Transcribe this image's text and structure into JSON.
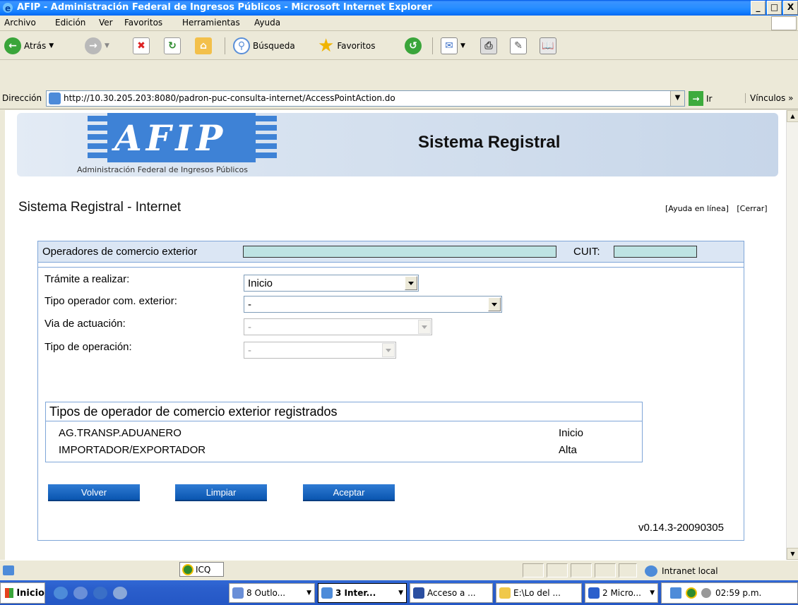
{
  "window": {
    "title": "AFIP - Administración Federal de Ingresos Públicos - Microsoft Internet Explorer",
    "min": "_",
    "max": "□",
    "close": "X"
  },
  "menu": [
    "Archivo",
    "Edición",
    "Ver",
    "Favoritos",
    "Herramientas",
    "Ayuda"
  ],
  "toolbar": {
    "back": "Atrás",
    "search": "Búsqueda",
    "favorites": "Favoritos"
  },
  "address": {
    "label": "Dirección",
    "url": "http://10.30.205.203:8080/padron-puc-consulta-internet/AccessPointAction.do",
    "go": "Ir",
    "links": "Vínculos »"
  },
  "header": {
    "logo_text": "AFIP",
    "agency": "Administración Federal de Ingresos Públicos",
    "system_title": "Sistema Registral"
  },
  "page": {
    "title": "Sistema Registral - Internet",
    "help_link": "[Ayuda en línea]",
    "close_link": "[Cerrar]"
  },
  "panel": {
    "operators_label": "Operadores de comercio exterior",
    "operators_value": "",
    "cuit_label": "CUIT:",
    "cuit_value": ""
  },
  "form": {
    "tramite_label": "Trámite a realizar:",
    "tramite_value": "Inicio",
    "tipo_operador_label": "Tipo operador com. exterior:",
    "tipo_operador_value": "-",
    "via_label": "Via de actuación:",
    "via_value": "-",
    "tipo_operacion_label": "Tipo de operación:",
    "tipo_operacion_value": "-"
  },
  "registered": {
    "title": "Tipos de operador de comercio exterior registrados",
    "rows": [
      {
        "type": "AG.TRANSP.ADUANERO",
        "status": "Inicio"
      },
      {
        "type": "IMPORTADOR/EXPORTADOR",
        "status": "Alta"
      }
    ]
  },
  "actions": {
    "back": "Volver",
    "clear": "Limpiar",
    "accept": "Aceptar"
  },
  "version": "v0.14.3-20090305",
  "statusbar": {
    "icq": "ICQ",
    "zone": "Intranet local"
  },
  "taskbar": {
    "start": "Inicio",
    "tasks": [
      "8 Outlo...",
      "3 Inter...",
      "Acceso a ...",
      "E:\\Lo del ...",
      "2 Micro..."
    ],
    "clock": "02:59 p.m."
  }
}
